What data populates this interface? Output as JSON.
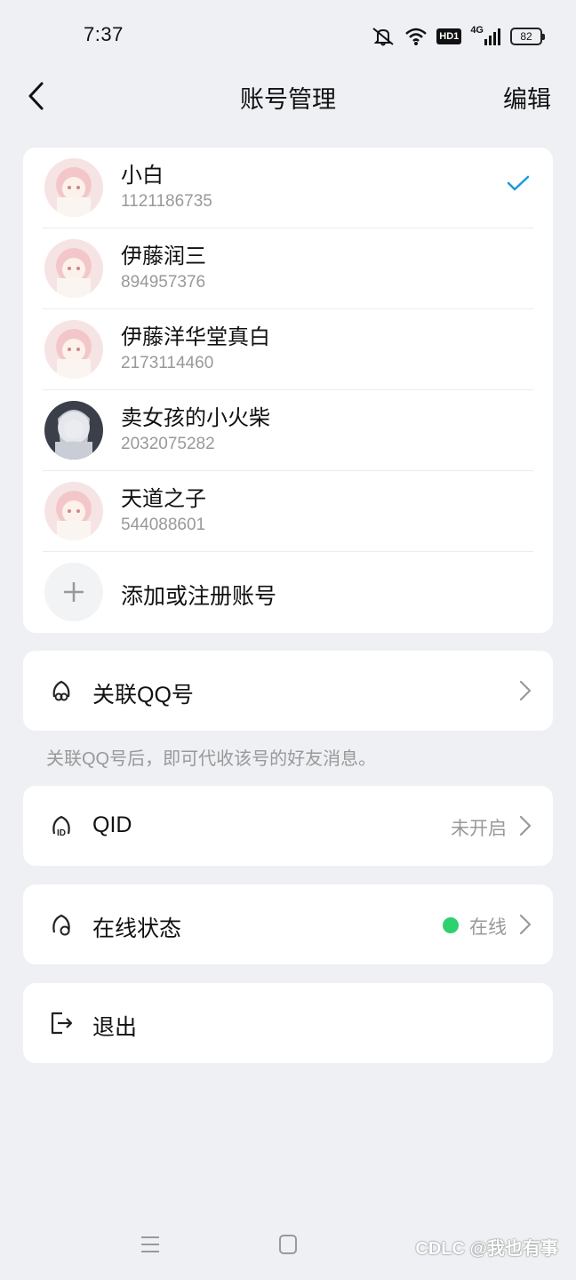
{
  "status_bar": {
    "time": "7:37",
    "icons": [
      "mute-bell-icon",
      "wifi-icon",
      "hd-icon",
      "signal-icon",
      "battery-icon"
    ],
    "hd_label": "HD1",
    "network": "4G",
    "battery": "82"
  },
  "nav": {
    "title": "账号管理",
    "edit_label": "编辑"
  },
  "accounts": [
    {
      "name": "小白",
      "id": "1121186735",
      "selected": true
    },
    {
      "name": "伊藤润三",
      "id": "894957376",
      "selected": false
    },
    {
      "name": "伊藤洋华堂真白",
      "id": "2173114460",
      "selected": false
    },
    {
      "name": "卖女孩的小火柴",
      "id": "2032075282",
      "selected": false
    },
    {
      "name": "天道之子",
      "id": "544088601",
      "selected": false
    }
  ],
  "add_account_label": "添加或注册账号",
  "link_qq": {
    "label": "关联QQ号",
    "hint": "关联QQ号后，即可代收该号的好友消息。"
  },
  "qid": {
    "label": "QID",
    "value": "未开启"
  },
  "online_status": {
    "label": "在线状态",
    "value": "在线",
    "dot_color": "#2ed070"
  },
  "logout": {
    "label": "退出"
  },
  "watermark": "CDLC @我也有事",
  "colors": {
    "background": "#eef0f4",
    "accent": "#1a9bd7",
    "online": "#2ed070"
  }
}
